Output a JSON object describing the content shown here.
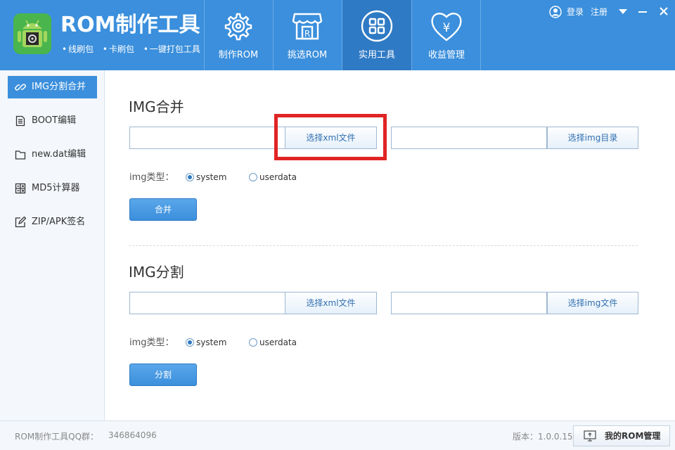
{
  "app": {
    "title": "ROM制作工具",
    "subtitle_items": [
      "线刷包",
      "卡刷包",
      "一键打包工具"
    ]
  },
  "nav": {
    "tabs": [
      {
        "label": "制作ROM",
        "icon": "gear-icon"
      },
      {
        "label": "挑选ROM",
        "icon": "store-icon"
      },
      {
        "label": "实用工具",
        "icon": "grid-icon",
        "active": true
      },
      {
        "label": "收益管理",
        "icon": "heart-yen-icon"
      }
    ]
  },
  "auth": {
    "login": "登录",
    "register": "注册"
  },
  "sidebar": {
    "items": [
      {
        "label": "IMG分割合并",
        "icon": "link-icon",
        "active": true
      },
      {
        "label": "BOOT编辑",
        "icon": "document-icon"
      },
      {
        "label": "new.dat编辑",
        "icon": "folder-icon"
      },
      {
        "label": "MD5计算器",
        "icon": "calculator-icon"
      },
      {
        "label": "ZIP/APK签名",
        "icon": "edit-icon"
      }
    ]
  },
  "merge": {
    "title": "IMG合并",
    "xml_value": "",
    "xml_button": "选择xml文件",
    "img_value": "",
    "img_button": "选择img目录",
    "type_label": "img类型：",
    "options": [
      "system",
      "userdata"
    ],
    "selected": "system",
    "action": "合并"
  },
  "split": {
    "title": "IMG分割",
    "xml_value": "",
    "xml_button": "选择xml文件",
    "img_value": "",
    "img_button": "选择img文件",
    "type_label": "img类型：",
    "options": [
      "system",
      "userdata"
    ],
    "selected": "system",
    "action": "分割"
  },
  "footer": {
    "qq_label": "ROM制作工具QQ群：",
    "qq_number": "346864096",
    "version": "版本：1.0.0.15",
    "my_rom_button": "我的ROM管理"
  },
  "colors": {
    "header": "#3b8fdc",
    "active_tab": "#2f7ac4",
    "highlight": "#e02424",
    "logo_green": "#49b54c"
  }
}
